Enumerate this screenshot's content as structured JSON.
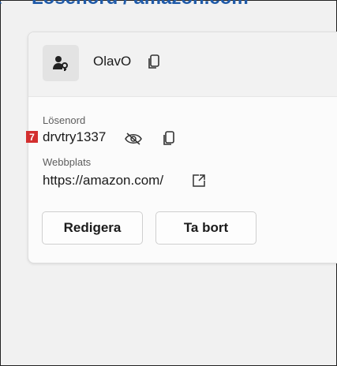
{
  "header": {
    "title": "Lösenord  /  amazon.com",
    "back_icon": "back-arrow-icon"
  },
  "account": {
    "username": "OlavO"
  },
  "password": {
    "label": "Lösenord",
    "value": "drvtry1337",
    "badge": "7"
  },
  "website": {
    "label": "Webbplats",
    "value": "https://amazon.com/"
  },
  "actions": {
    "edit_label": "Redigera",
    "delete_label": "Ta bort"
  },
  "colors": {
    "accent": "#1f5aa8",
    "badge": "#d32f2f"
  }
}
